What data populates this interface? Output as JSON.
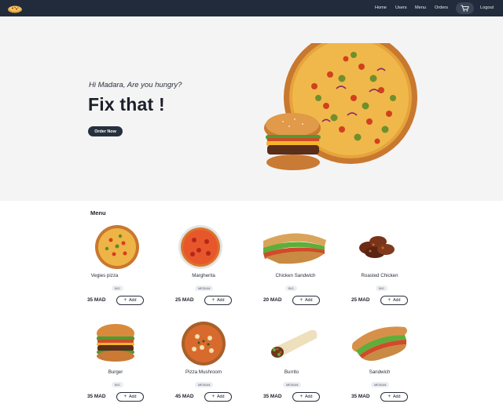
{
  "nav": {
    "links": [
      "Home",
      "Users",
      "Menu",
      "Orders"
    ],
    "logout": "Logout"
  },
  "hero": {
    "greeting": "Hi Madara, Are you hungry?",
    "headline": "Fix that !",
    "order_button": "Order Now"
  },
  "menu": {
    "title": "Menu",
    "items": [
      {
        "name": "Vegies pizza",
        "size": "BIG",
        "price": "35 MAD",
        "add": "Add"
      },
      {
        "name": "Margherita",
        "size": "MEDIUM",
        "price": "25 MAD",
        "add": "Add"
      },
      {
        "name": "Chicken Sandwich",
        "size": "BIG",
        "price": "20 MAD",
        "add": "Add"
      },
      {
        "name": "Roasted Chicken",
        "size": "BIG",
        "price": "25 MAD",
        "add": "Add"
      },
      {
        "name": "Burger",
        "size": "BIG",
        "price": "35 MAD",
        "add": "Add"
      },
      {
        "name": "Pizza Mushroom",
        "size": "MEDIUM",
        "price": "45 MAD",
        "add": "Add"
      },
      {
        "name": "Burrito",
        "size": "MEDIUM",
        "price": "35 MAD",
        "add": "Add"
      },
      {
        "name": "Sandwich",
        "size": "MEDIUM",
        "price": "35 MAD",
        "add": "Add"
      }
    ]
  },
  "colors": {
    "navbar": "#222b3c",
    "accent": "#26303f",
    "hero_bg": "#f4f4f4"
  },
  "icons": {
    "logo": "pizza-logo-icon",
    "cart": "cart-icon",
    "plus": "plus-icon"
  }
}
